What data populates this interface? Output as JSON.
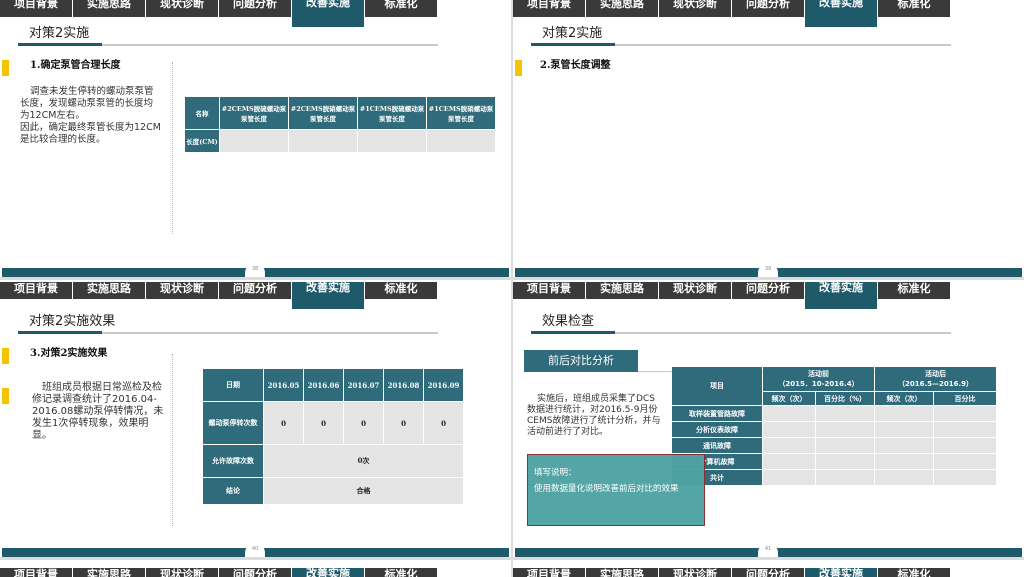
{
  "nav": [
    "项目背景",
    "实施思路",
    "现状诊断",
    "问题分析",
    "改善实施",
    "标准化"
  ],
  "slide1": {
    "title": "对策2实施",
    "subhead": "1.确定泵管合理长度",
    "paragraph": "调查未发生停转的螺动泵泵管长度，发现螺动泵泵管的长度均为12CM左右。\n因此，确定最终泵管长度为12CM是比较合理的长度。",
    "table": {
      "corner": "名称",
      "headers": [
        "#2CEMS脱硫螺动泵泵管长度",
        "#2CEMS脱硝螺动泵泵管长度",
        "#1CEMS脱硫螺动泵泵管长度",
        "#1CEMS脱硝螺动泵泵管长度"
      ],
      "row_label": "长度(CM)"
    },
    "page": "38"
  },
  "slide2": {
    "title": "对策2实施",
    "subhead": "2.泵管长度调整",
    "page": "39"
  },
  "slide3": {
    "title": "对策2实施效果",
    "subhead": "3.对策2实施效果",
    "paragraph": "班组成员根据日常巡检及检修记录调查统计了2016.04-2016.08螺动泵停转情况，未发生1次停转现象，效果明显。",
    "table": {
      "corner": "日期",
      "dates": [
        "2016.05",
        "2016.06",
        "2016.07",
        "2016.08",
        "2016.09"
      ],
      "row1_label": "螺动泵停转次数",
      "row1_values": [
        "0",
        "0",
        "0",
        "0",
        "0"
      ],
      "row2_label": "允许故障次数",
      "row2_value": "0次",
      "row3_label": "结论",
      "row3_value": "合格"
    },
    "page": "40"
  },
  "slide4": {
    "title": "效果检查",
    "button": "前后对比分析",
    "paragraph": "实施后，班组成员采集了DCS数据进行统计，对2016.5-9月份CEMS故障进行了统计分析，并与活动前进行了对比。",
    "table": {
      "item": "项目",
      "before": "活动前\n（2015．10-2016.4）",
      "after": "活动后\n（2016.5—2016.9）",
      "freq": "频次（次）",
      "pct_before": "百分比（%）",
      "pct_after": "百分比",
      "rows": [
        "取样装置管路故障",
        "分析仪表故障",
        "通讯故障",
        "计算机故障",
        "共计"
      ]
    },
    "note_title": "填写说明：",
    "note_body": "使用数据量化说明改善前后对比的效果",
    "page": "41"
  },
  "colors": {
    "teal": "#1f5a6b",
    "table_header": "#2f6b7b",
    "accent_yellow": "#f5c400",
    "note_bg": "#4fa3a3"
  }
}
